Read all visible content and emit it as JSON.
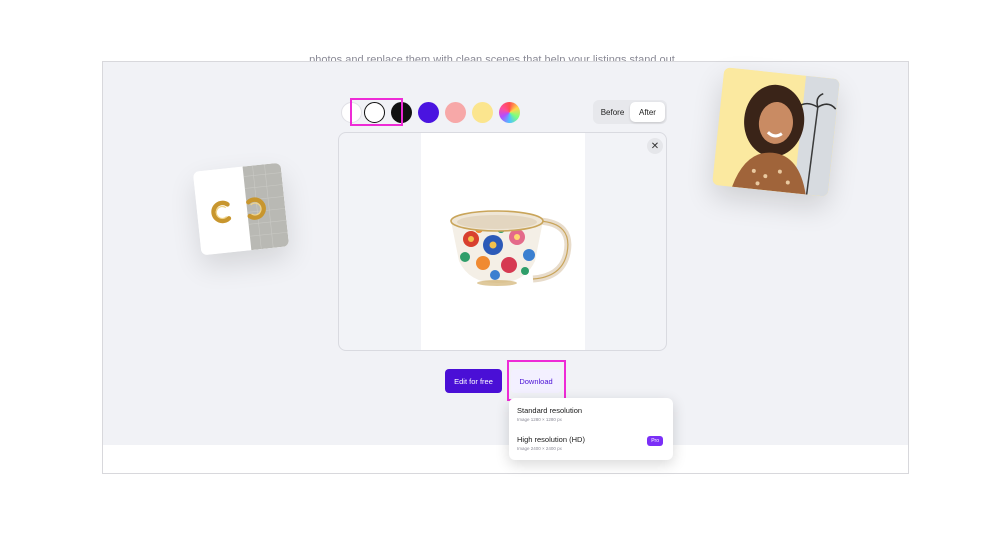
{
  "page": {
    "subtitle": "photos and replace them with clean scenes that help your listings stand out."
  },
  "background_picker": {
    "swatches": [
      {
        "name": "transparent",
        "color": "#ffffff"
      },
      {
        "name": "white",
        "color": "#ffffff",
        "selected": true
      },
      {
        "name": "black",
        "color": "#111111"
      },
      {
        "name": "blue",
        "color": "#4a14e0"
      },
      {
        "name": "pink",
        "color": "#f7a8a8"
      },
      {
        "name": "yellow",
        "color": "#fbe58e"
      },
      {
        "name": "rainbow",
        "color": "multi"
      }
    ]
  },
  "view_toggle": {
    "before_label": "Before",
    "after_label": "After",
    "active": "After"
  },
  "preview": {
    "close_icon": "close-icon",
    "image": "floral-teacup"
  },
  "actions": {
    "edit_label": "Edit for free",
    "download_label": "Download"
  },
  "download_menu": {
    "items": [
      {
        "title": "Standard resolution",
        "subtitle": "Image 1280 × 1280 px"
      },
      {
        "title": "High resolution (HD)",
        "subtitle": "Image 2400 × 2400 px",
        "badge": "Pro"
      }
    ]
  },
  "colors": {
    "accent": "#4a0fd6",
    "highlight": "#ee2bd6",
    "badge": "#7b2ff7"
  }
}
